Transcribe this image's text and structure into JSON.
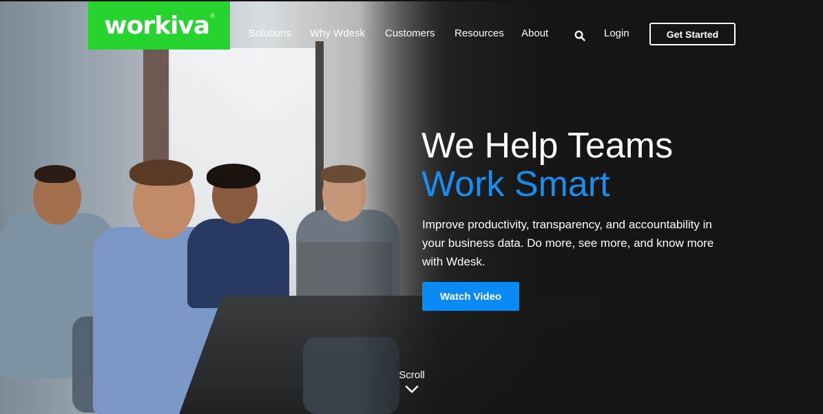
{
  "brand": {
    "logo_text": "workiva",
    "logo_color": "#27d32f"
  },
  "nav": {
    "items": [
      "Solutions",
      "Why Wdesk",
      "Customers",
      "Resources",
      "About"
    ],
    "search_icon": "search-icon",
    "login_label": "Login",
    "cta_label": "Get Started"
  },
  "hero": {
    "headline_line1": "We Help Teams",
    "headline_line2": "Work Smart",
    "accent_color": "#1a8ef0",
    "subcopy": "Improve productivity, transparency, and accountability in your business data. Do more, see more, and know more with Wdesk.",
    "button_label": "Watch Video",
    "button_color": "#0a8af5"
  },
  "scroll": {
    "label": "Scroll",
    "icon": "chevron-down-icon"
  }
}
